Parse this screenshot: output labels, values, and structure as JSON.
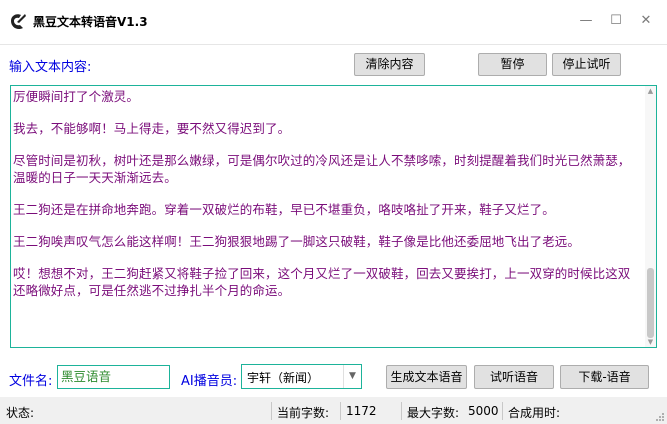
{
  "window": {
    "title": "黑豆文本转语音V1.3",
    "minimize_glyph": "—",
    "maximize_glyph": "☐",
    "close_glyph": "✕"
  },
  "toolbar": {
    "input_label": "输入文本内容:",
    "clear_label": "清除内容",
    "pause_label": "暂停",
    "stop_label": "停止试听"
  },
  "editor": {
    "paragraphs": [
      "厉便瞬间打了个激灵。",
      "我去，不能够啊！马上得走，要不然又得迟到了。",
      "尽管时间是初秋，树叶还是那么嫩绿，可是偶尔吹过的冷风还是让人不禁哆嗦，时刻提醒着我们时光已然萧瑟，温暖的日子一天天渐渐远去。",
      "王二狗还是在拼命地奔跑。穿着一双破烂的布鞋，早已不堪重负，咯吱咯扯了开来，鞋子又烂了。",
      "王二狗唉声叹气怎么能这样啊！王二狗狠狠地踢了一脚这只破鞋，鞋子像是比他还委屈地飞出了老远。",
      "哎！想想不对，王二狗赶紧又将鞋子捡了回来，这个月又烂了一双破鞋，回去又要挨打，上一双穿的时候比这双还略微好点，可是任然逃不过挣扎半个月的命运。"
    ]
  },
  "bottom": {
    "filename_label": "文件名:",
    "filename_value": "黑豆语音",
    "voice_label": "AI播音员:",
    "voice_value": "宇轩（新闻）",
    "generate_label": "生成文本语音",
    "preview_label": "试听语音",
    "download_label": "下载-语音"
  },
  "status": {
    "state_label": "状态:",
    "current_chars_label": "当前字数:",
    "current_chars_value": "1172",
    "max_chars_label": "最大字数:",
    "max_chars_value": "5000",
    "synth_time_label": "合成用时:"
  },
  "colors": {
    "label_blue": "#0000e0",
    "text_purple": "#7a0c7a",
    "border_teal": "#1db39a",
    "filename_green": "#2e8b2e"
  }
}
